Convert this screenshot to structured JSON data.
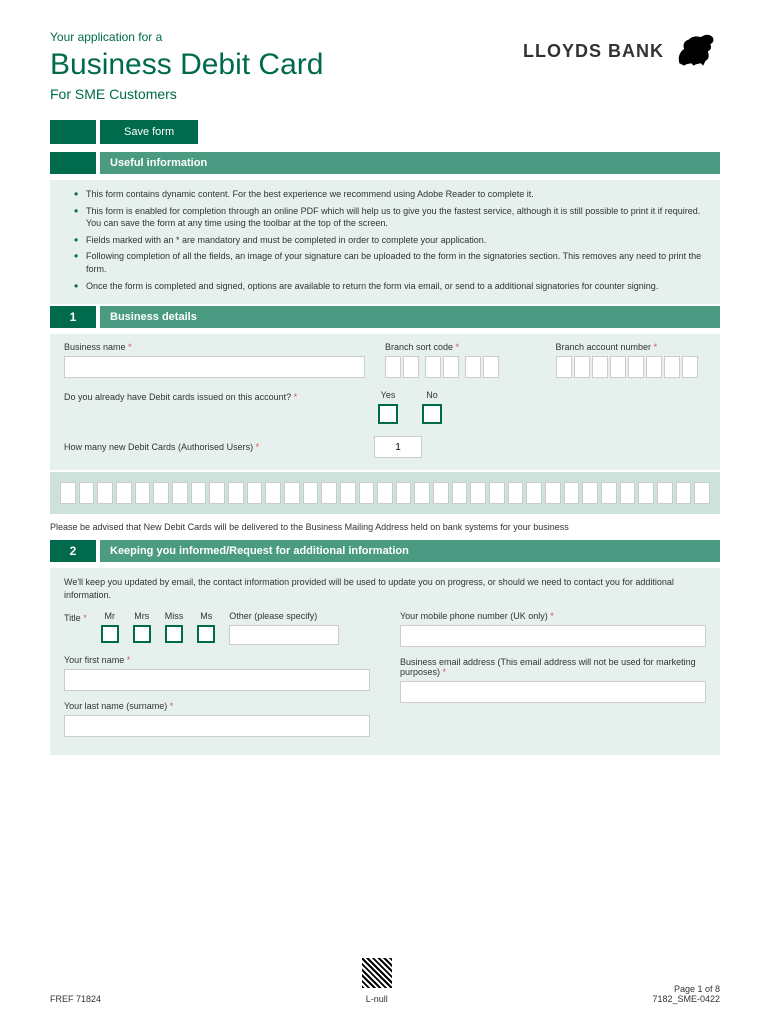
{
  "header": {
    "pretitle": "Your application for a",
    "title": "Business Debit Card",
    "subtitle": "For SME Customers",
    "logo_text": "LLOYDS BANK"
  },
  "save_button": "Save form",
  "useful_info": {
    "title": "Useful information",
    "items": [
      "This form contains dynamic content. For the best experience we recommend using Adobe Reader to complete it.",
      "This form is enabled for completion through an online PDF which will help us to give you the fastest service, although it is still possible to print it if required. You can save the form at any time using the toolbar at the top of the screen.",
      "Fields marked with an * are mandatory and must be completed in order to complete your application.",
      "Following completion of all the fields, an image of your signature can be uploaded to the form in the signatories section. This removes any need to print the form.",
      "Once the form is completed and signed, options are available to return the form via email, or send to a additional signatories for counter signing."
    ]
  },
  "section1": {
    "num": "1",
    "title": "Business details",
    "business_name_label": "Business name",
    "sort_code_label": "Branch sort code",
    "acct_num_label": "Branch account number",
    "existing_debit_label": "Do you already have Debit cards issued on this account?",
    "yes": "Yes",
    "no": "No",
    "how_many_label": "How many new Debit Cards (Authorised Users)",
    "how_many_value": "1",
    "advisory": "Please be advised that New Debit Cards will be delivered to the Business Mailing Address held on bank systems for your business"
  },
  "section2": {
    "num": "2",
    "title": "Keeping you informed/Request for additional information",
    "intro": "We'll keep you updated by email, the contact information provided will be used to update you on progress, or should we need to contact you for additional information.",
    "title_label": "Title",
    "title_options": [
      "Mr",
      "Mrs",
      "Miss",
      "Ms"
    ],
    "other_label": "Other (please specify)",
    "first_name_label": "Your first name",
    "last_name_label": "Your last name (surname)",
    "mobile_label": "Your mobile phone number (UK only)",
    "email_label": "Business email address (This email address will not be used for marketing purposes)"
  },
  "footer": {
    "left": "FREF 71824",
    "center": "L-null",
    "page": "Page 1 of 8",
    "code": "7182_SME-0422"
  }
}
